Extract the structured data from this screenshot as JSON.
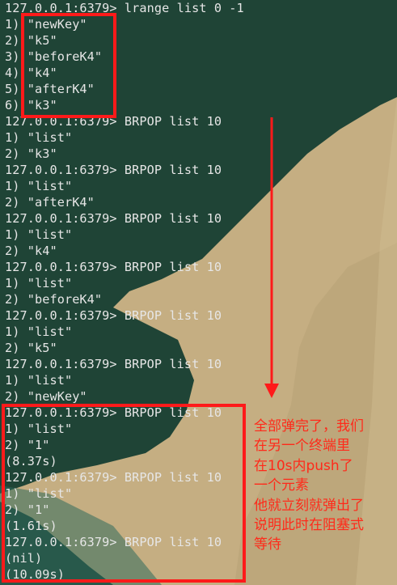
{
  "terminal": {
    "lines": [
      "127.0.0.1:6379> lrange list 0 -1",
      "1) \"newKey\"",
      "2) \"k5\"",
      "3) \"beforeK4\"",
      "4) \"k4\"",
      "5) \"afterK4\"",
      "6) \"k3\"",
      "127.0.0.1:6379> BRPOP list 10",
      "1) \"list\"",
      "2) \"k3\"",
      "127.0.0.1:6379> BRPOP list 10",
      "1) \"list\"",
      "2) \"afterK4\"",
      "127.0.0.1:6379> BRPOP list 10",
      "1) \"list\"",
      "2) \"k4\"",
      "127.0.0.1:6379> BRPOP list 10",
      "1) \"list\"",
      "2) \"beforeK4\"",
      "127.0.0.1:6379> BRPOP list 10",
      "1) \"list\"",
      "2) \"k5\"",
      "127.0.0.1:6379> BRPOP list 10",
      "1) \"list\"",
      "2) \"newKey\"",
      "127.0.0.1:6379> BRPOP list 10",
      "1) \"list\"",
      "2) \"1\"",
      "(8.37s)",
      "127.0.0.1:6379> BRPOP list 10",
      "1) \"list\"",
      "2) \"1\"",
      "(1.61s)",
      "127.0.0.1:6379> BRPOP list 10",
      "(nil)",
      "(10.09s)"
    ]
  },
  "annotation": {
    "text": "全部弹完了，我们\n在另一个终端里\n在10s内push了\n一个元素\n他就立刻就弹出了\n说明此时在阻塞式\n等待"
  },
  "colors": {
    "annotation_red": "#ff1a1a",
    "terminal_text": "#e6e6e6",
    "wallpaper_green": "#1f4436",
    "wallpaper_beige": "#c9b387"
  }
}
